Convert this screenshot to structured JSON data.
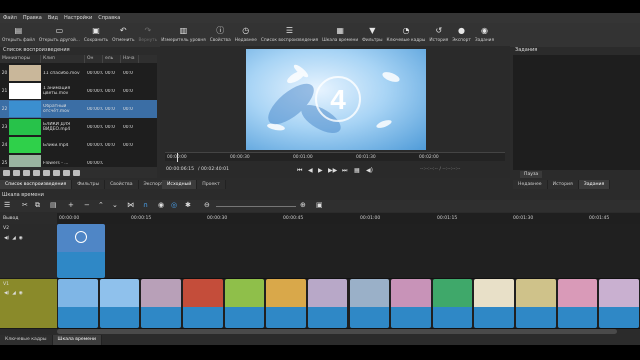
{
  "menu": [
    "Файл",
    "Правка",
    "Вид",
    "Настройки",
    "Справка"
  ],
  "toolbar": [
    {
      "label": "Открыть файл",
      "icon": "file-open-icon",
      "glyph": "▤",
      "enabled": true
    },
    {
      "label": "Открыть другой...",
      "icon": "folder-icon",
      "glyph": "▭",
      "enabled": true
    },
    {
      "label": "Сохранить",
      "icon": "save-icon",
      "glyph": "▣",
      "enabled": true
    },
    {
      "label": "Отменить",
      "icon": "undo-icon",
      "glyph": "↶",
      "enabled": true
    },
    {
      "label": "Вернуть",
      "icon": "redo-icon",
      "glyph": "↷",
      "enabled": false
    },
    {
      "label": "Измеритель уровня",
      "icon": "level-meter-icon",
      "glyph": "▥",
      "enabled": true
    },
    {
      "label": "Свойства",
      "icon": "properties-icon",
      "glyph": "ⓘ",
      "enabled": true
    },
    {
      "label": "Недавнее",
      "icon": "recent-icon",
      "glyph": "◷",
      "enabled": true
    },
    {
      "label": "Список воспроизведения",
      "icon": "playlist-icon",
      "glyph": "☰",
      "enabled": true
    },
    {
      "label": "Шкала времени",
      "icon": "timeline-icon",
      "glyph": "▦",
      "enabled": true
    },
    {
      "label": "Фильтры",
      "icon": "filter-icon",
      "glyph": "▼",
      "enabled": true
    },
    {
      "label": "Ключевые кадры",
      "icon": "keyframes-icon",
      "glyph": "◔",
      "enabled": true
    },
    {
      "label": "История",
      "icon": "history-icon",
      "glyph": "↺",
      "enabled": true
    },
    {
      "label": "Экспорт",
      "icon": "export-icon",
      "glyph": "●",
      "enabled": true
    },
    {
      "label": "Задания",
      "icon": "jobs-icon",
      "glyph": "◉",
      "enabled": true
    }
  ],
  "playlist": {
    "title": "Список воспроизведения",
    "columns": [
      "Миниатюры",
      "Клип",
      "Он",
      "ель",
      "Нача"
    ],
    "rows": [
      {
        "num": "20",
        "name": "11 спасибо.mov",
        "in": "00:00:00:00",
        "out": "00:0",
        "start": "00:0",
        "thumb": "#c9b79a",
        "selected": false
      },
      {
        "num": "21",
        "name": "1 анимация цветы.mov",
        "in": "00:00:00:00",
        "out": "00:0",
        "start": "00:0",
        "thumb": "#ffffff",
        "selected": false
      },
      {
        "num": "22",
        "name": "Обратный отсчёт.mov",
        "in": "00:00:00:00",
        "out": "00:0",
        "start": "00:0",
        "thumb": "#3b8fd0",
        "selected": true
      },
      {
        "num": "23",
        "name": "БЛИКИ ДЛЯ ВИДЕО.mp4",
        "in": "00:00:00:00",
        "out": "00:0",
        "start": "00:0",
        "thumb": "#27c24a",
        "selected": false
      },
      {
        "num": "24",
        "name": "Блики.mp4",
        "in": "00:00:00:00",
        "out": "00:0",
        "start": "00:0",
        "thumb": "#2fd04a",
        "selected": false
      },
      {
        "num": "25",
        "name": "Flowers - ...",
        "in": "00:00:00:00",
        "out": "",
        "start": "",
        "thumb": "#9ab3a0",
        "selected": false
      }
    ]
  },
  "left_tabs": [
    "Список воспроизведения",
    "Фильтры",
    "Свойства",
    "Экспорт"
  ],
  "preview_tabs": [
    "Исходный",
    "Проект"
  ],
  "preview": {
    "countdown": "4",
    "ticks": [
      "00:00:00",
      "00:00:30",
      "00:01:00",
      "00:01:30",
      "00:02:00"
    ],
    "timecode": "00:00:06:15",
    "duration": "/ 00:02:40:01",
    "in_out": "--:--:--:-- / --:--:--:--"
  },
  "right_panel": {
    "title": "Задания",
    "pause": "Пауза",
    "tabs": [
      "Недавнее",
      "История",
      "Задания"
    ]
  },
  "timeline": {
    "title": "Шкала времени",
    "ruler": [
      "00:00:00",
      "00:00:15",
      "00:00:30",
      "00:00:45",
      "00:01:00",
      "00:01:15",
      "00:01:30",
      "00:01:45"
    ],
    "output_label": "Вывод",
    "tracks": [
      "V2",
      "V1"
    ]
  },
  "status_tabs": [
    "Ключевые кадры",
    "Шкала времени"
  ]
}
